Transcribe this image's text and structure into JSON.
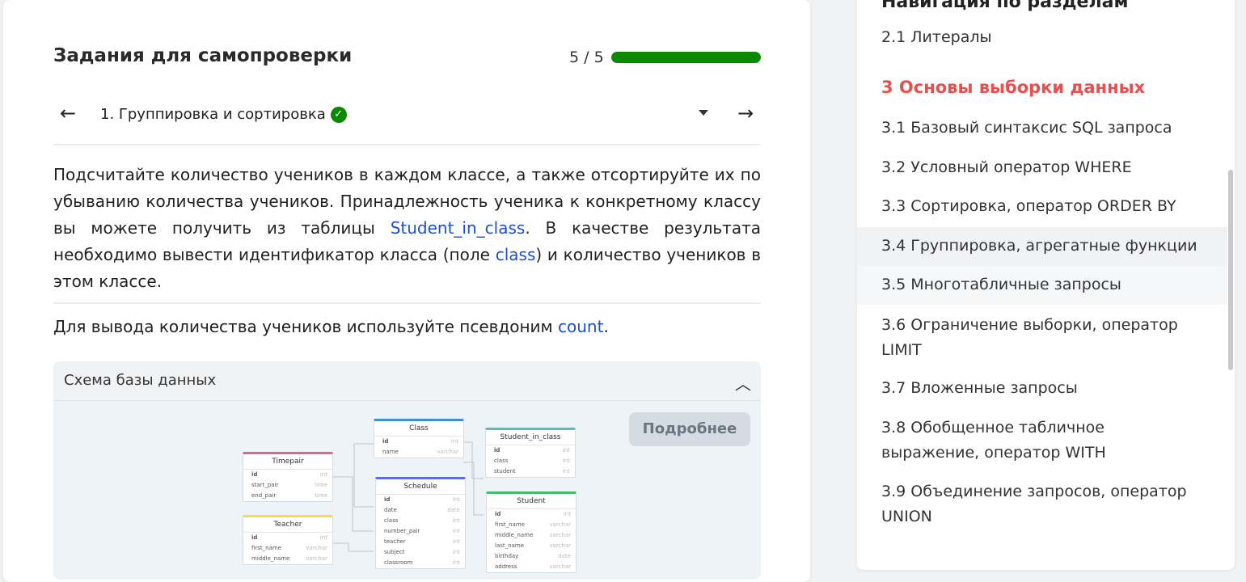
{
  "task": {
    "title": "Задания для самопроверки",
    "progress_text": "5 / 5",
    "progress_fraction": 1.0,
    "current_task": "1. Группировка и сортировка",
    "text_part1": "Подсчитайте количество учеников в каждом классе, а также отсортируйте их по убыванию количества учеников. Принадлежность ученика к конкретному классу вы можете получить из таблицы ",
    "link_table": "Student_in_class",
    "text_part2": ". В качестве результата необходимо вывести идентификатор класса (поле ",
    "link_field": "class",
    "text_part3": ") и количество учеников в этом классе.",
    "hint_part1": "Для вывода количества учеников используйте псевдоним ",
    "hint_link": "count",
    "hint_part2": "."
  },
  "schema": {
    "title": "Схема базы данных",
    "more_button": "Подробнее",
    "tables": {
      "timepair": {
        "name": "Timepair",
        "rows": [
          [
            "id",
            "int"
          ],
          [
            "start_pair",
            "time"
          ],
          [
            "end_pair",
            "time"
          ]
        ]
      },
      "teacher": {
        "name": "Teacher",
        "rows": [
          [
            "id",
            "int"
          ],
          [
            "first_name",
            "varchar"
          ],
          [
            "middle_name",
            "varchar"
          ]
        ]
      },
      "class": {
        "name": "Class",
        "rows": [
          [
            "id",
            "int"
          ],
          [
            "name",
            "varchar"
          ]
        ]
      },
      "schedule": {
        "name": "Schedule",
        "rows": [
          [
            "id",
            "int"
          ],
          [
            "date",
            "date"
          ],
          [
            "class",
            "int"
          ],
          [
            "number_pair",
            "int"
          ],
          [
            "teacher",
            "int"
          ],
          [
            "subject",
            "int"
          ],
          [
            "classroom",
            "int"
          ]
        ]
      },
      "student_in_class": {
        "name": "Student_in_class",
        "rows": [
          [
            "id",
            "int"
          ],
          [
            "class",
            "int"
          ],
          [
            "student",
            "int"
          ]
        ]
      },
      "student": {
        "name": "Student",
        "rows": [
          [
            "id",
            "int"
          ],
          [
            "first_name",
            "varchar"
          ],
          [
            "middle_name",
            "varchar"
          ],
          [
            "last_name",
            "varchar"
          ],
          [
            "birthday",
            "date"
          ],
          [
            "address",
            "varchar"
          ]
        ]
      }
    }
  },
  "sidebar": {
    "title": "Навигация по разделам",
    "item_2_1": "2.1 Литералы",
    "section_3": "3 Основы выборки данных",
    "item_3_1": "3.1 Базовый синтаксис SQL запроса",
    "item_3_2": "3.2 Условный оператор WHERE",
    "item_3_3": "3.3 Сортировка, оператор ORDER BY",
    "item_3_4": "3.4 Группировка, агрегатные функции",
    "item_3_5": "3.5 Многотабличные запросы",
    "item_3_6": "3.6 Ограничение выборки, оператор LIMIT",
    "item_3_7": "3.7 Вложенные запросы",
    "item_3_8": "3.8 Обобщенное табличное выражение, оператор WITH",
    "item_3_9": "3.9 Объединение запросов, оператор UNION"
  },
  "colors": {
    "progress": "#0b8a00",
    "link": "#1a4fd6",
    "section": "#ea4f4f",
    "timepair": "#e8608a",
    "teacher": "#f2dc4b",
    "class": "#3a8fd9",
    "schedule": "#5b6fd6",
    "student_in_class": "#4fc4b3",
    "student": "#3fbf6a"
  }
}
